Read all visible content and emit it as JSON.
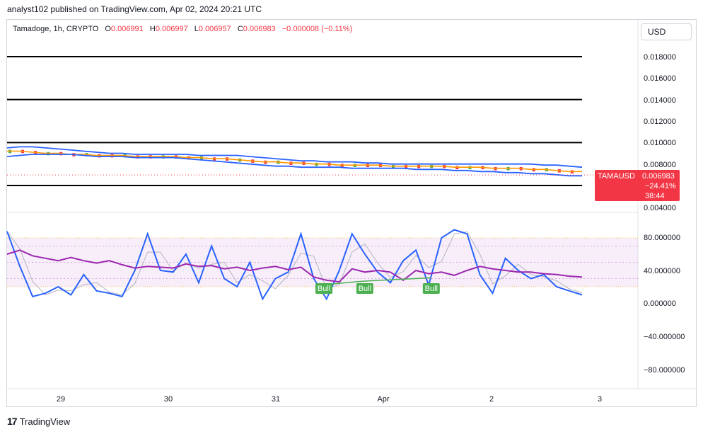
{
  "header": {
    "text": "analyst102 published on TradingView.com, Apr 02, 2024 20:21 UTC"
  },
  "legend": {
    "symbol": "Tamadoge, 1h, CRYPTO",
    "o_label": "O",
    "o": "0.006991",
    "h_label": "H",
    "h": "0.006997",
    "l_label": "L",
    "l": "0.006957",
    "c_label": "C",
    "c": "0.006983",
    "change": "−0.000008 (−0.11%)"
  },
  "currency_button": "USD",
  "price_tag": {
    "symbol": "TAMAUSD",
    "price": "0.006983",
    "change": "−24.41%",
    "countdown": "38:44",
    "color": "#f23645"
  },
  "footer": {
    "logo": "17",
    "brand": "TradingView"
  },
  "colors": {
    "bb": "#2962ff",
    "ma": "#ff9800",
    "rsi": "#9c27b0",
    "stoch": "#2962ff",
    "bull": "#4caf50",
    "bear": "#f23645"
  },
  "chart_data": [
    {
      "type": "line",
      "panel": "price",
      "title": "Tamadoge, 1h, CRYPTO",
      "y_ticks": [
        "0.018000",
        "0.016000",
        "0.014000",
        "0.012000",
        "0.010000",
        "0.008000",
        "0.004000"
      ],
      "ylim": [
        0.004,
        0.019
      ],
      "horizontal_levels": [
        0.018,
        0.014,
        0.01,
        0.006
      ],
      "x_ticks": [
        "29",
        "30",
        "31",
        "Apr",
        "2",
        "3"
      ],
      "x_index": [
        0,
        5,
        10,
        15,
        20,
        25,
        30,
        35,
        40,
        45,
        50,
        55,
        60,
        65,
        70,
        75,
        80,
        85,
        90,
        95,
        100,
        105,
        110,
        115,
        120,
        125,
        130,
        135,
        140,
        145,
        150,
        155,
        160,
        165,
        170,
        175,
        180,
        185,
        190,
        195,
        200,
        205,
        210,
        215,
        220,
        225
      ],
      "series": [
        {
          "values": [
            0.0094,
            0.0094,
            0.0093,
            0.0092,
            0.0092,
            0.0091,
            0.009,
            0.0089,
            0.0089,
            0.0088,
            0.0087,
            0.0087,
            0.0086,
            0.0086,
            0.0086,
            0.0085,
            0.0085,
            0.0084,
            0.0084,
            0.0083,
            0.0082,
            0.0081,
            0.008,
            0.008,
            0.0079,
            0.0079,
            0.0078,
            0.0078,
            0.0078,
            0.0078,
            0.0077,
            0.0077,
            0.0077,
            0.0077,
            0.0076,
            0.0076,
            0.0076,
            0.0075,
            0.0075,
            0.0074,
            0.0073,
            0.0073,
            0.0072,
            0.0071,
            0.0071,
            0.007
          ]
        },
        {
          "values": [
            0.0092,
            0.0092,
            0.0091,
            0.009,
            0.009,
            0.0089,
            0.0089,
            0.0088,
            0.0088,
            0.0088,
            0.0087,
            0.0087,
            0.0087,
            0.0087,
            0.0086,
            0.0086,
            0.0085,
            0.0085,
            0.0084,
            0.0083,
            0.0082,
            0.0082,
            0.0081,
            0.0081,
            0.008,
            0.008,
            0.0079,
            0.0079,
            0.0079,
            0.0079,
            0.0078,
            0.0078,
            0.0078,
            0.0078,
            0.0078,
            0.0077,
            0.0077,
            0.0077,
            0.0076,
            0.0076,
            0.0076,
            0.0075,
            0.0075,
            0.0074,
            0.0073,
            0.0073
          ]
        },
        {
          "values": [
            0.0095,
            0.0096,
            0.0096,
            0.0095,
            0.0094,
            0.0093,
            0.0092,
            0.0091,
            0.009,
            0.009,
            0.0089,
            0.0089,
            0.0089,
            0.0089,
            0.0089,
            0.0088,
            0.0088,
            0.0088,
            0.0088,
            0.0087,
            0.0086,
            0.0085,
            0.0084,
            0.0083,
            0.0083,
            0.0082,
            0.0082,
            0.0082,
            0.0081,
            0.0081,
            0.008,
            0.008,
            0.008,
            0.008,
            0.008,
            0.008,
            0.008,
            0.008,
            0.008,
            0.008,
            0.008,
            0.008,
            0.0079,
            0.0079,
            0.0078,
            0.0077
          ]
        },
        {
          "values": [
            0.0087,
            0.0088,
            0.0089,
            0.0089,
            0.0089,
            0.0089,
            0.0088,
            0.0087,
            0.0087,
            0.0087,
            0.0086,
            0.0086,
            0.0086,
            0.0086,
            0.0085,
            0.0084,
            0.0083,
            0.0082,
            0.0081,
            0.008,
            0.0079,
            0.0078,
            0.0078,
            0.0077,
            0.0077,
            0.0077,
            0.0077,
            0.0076,
            0.0076,
            0.0076,
            0.0076,
            0.0076,
            0.0075,
            0.0075,
            0.0075,
            0.0074,
            0.0074,
            0.0073,
            0.0073,
            0.0072,
            0.0072,
            0.0071,
            0.0071,
            0.007,
            0.0069,
            0.0069
          ]
        }
      ]
    },
    {
      "type": "line",
      "panel": "oscillator",
      "y_ticks": [
        "80.000000",
        "40.000000",
        "0.000000",
        "−40.000000",
        "−80.000000"
      ],
      "ylim": [
        -100,
        100
      ],
      "band": [
        20,
        80
      ],
      "midlines": [
        30,
        50,
        70
      ],
      "x_index": [
        0,
        5,
        10,
        15,
        20,
        25,
        30,
        35,
        40,
        45,
        50,
        55,
        60,
        65,
        70,
        75,
        80,
        85,
        90,
        95,
        100,
        105,
        110,
        115,
        120,
        125,
        130,
        135,
        140,
        145,
        150,
        155,
        160,
        165,
        170,
        175,
        180,
        185,
        190,
        195,
        200,
        205,
        210,
        215,
        220,
        225
      ],
      "series": [
        {
          "values": [
            60,
            65,
            58,
            55,
            52,
            56,
            52,
            49,
            52,
            47,
            43,
            45,
            44,
            43,
            48,
            45,
            46,
            42,
            44,
            40,
            43,
            45,
            41,
            44,
            32,
            28,
            26,
            42,
            38,
            40,
            38,
            28,
            40,
            36,
            38,
            34,
            40,
            45,
            42,
            40,
            38,
            38,
            36,
            35,
            33,
            32
          ]
        },
        {
          "values": [
            88,
            45,
            8,
            12,
            20,
            10,
            35,
            15,
            12,
            8,
            40,
            85,
            40,
            38,
            60,
            25,
            70,
            30,
            20,
            50,
            5,
            30,
            38,
            85,
            30,
            5,
            40,
            85,
            60,
            38,
            25,
            52,
            65,
            22,
            80,
            90,
            85,
            35,
            12,
            55,
            40,
            30,
            35,
            20,
            15,
            10
          ]
        }
      ],
      "markers": [
        {
          "label": "Bull",
          "index": 124
        },
        {
          "label": "Bull",
          "index": 140
        },
        {
          "label": "Bull",
          "index": 166
        }
      ]
    }
  ]
}
